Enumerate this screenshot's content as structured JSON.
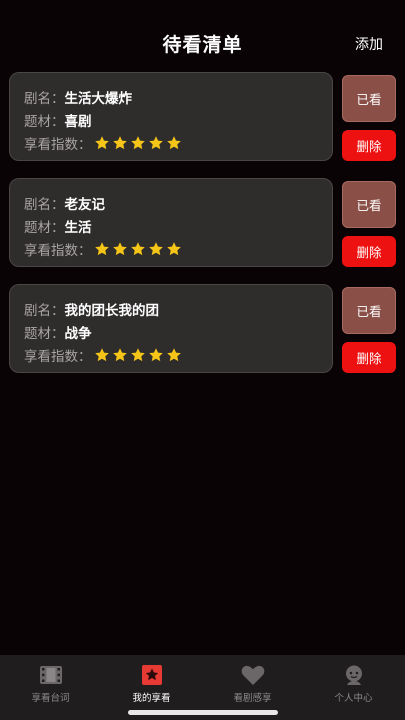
{
  "header": {
    "title": "待看清单",
    "add_label": "添加"
  },
  "labels": {
    "name": "剧名：",
    "genre": "题材：",
    "rating": "享看指数："
  },
  "actions": {
    "watched": "已看",
    "delete": "删除"
  },
  "items": [
    {
      "name": "生活大爆炸",
      "genre": "喜剧",
      "rating": 5
    },
    {
      "name": "老友记",
      "genre": "生活",
      "rating": 5
    },
    {
      "name": "我的团长我的团",
      "genre": "战争",
      "rating": 5
    }
  ],
  "tabs": [
    {
      "label": "享看台词",
      "icon": "film-icon",
      "active": false
    },
    {
      "label": "我的享看",
      "icon": "bookmark-star-icon",
      "active": true
    },
    {
      "label": "看剧感享",
      "icon": "heart-icon",
      "active": false
    },
    {
      "label": "个人中心",
      "icon": "user-face-icon",
      "active": false
    }
  ],
  "colors": {
    "accent": "#ee1111",
    "watched_button": "#8a5048",
    "star": "#f5c518",
    "card": "#2f2d2c"
  }
}
